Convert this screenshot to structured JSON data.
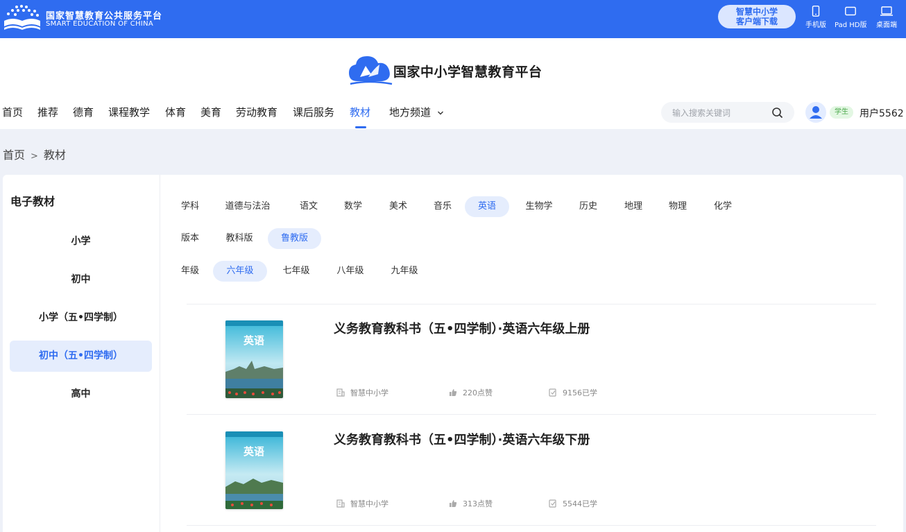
{
  "topbar": {
    "org_name_cn": "国家智慧教育公共服务平台",
    "org_name_en": "SMART EDUCATION OF CHINA",
    "download_line1": "智慧中小学",
    "download_line2": "客户端下载",
    "devices": [
      {
        "icon": "phone-icon",
        "label": "手机版"
      },
      {
        "icon": "tablet-icon",
        "label": "Pad HD版"
      },
      {
        "icon": "laptop-icon",
        "label": "桌面端"
      }
    ]
  },
  "header": {
    "brand": "国家中小学智慧教育平台",
    "nav": [
      "首页",
      "推荐",
      "德育",
      "课程教学",
      "体育",
      "美育",
      "劳动教育",
      "课后服务",
      "教材",
      "地方频道"
    ],
    "active_nav": "教材",
    "search_placeholder": "输入搜索关键词",
    "role": "学生",
    "username": "用户5562"
  },
  "breadcrumb": {
    "home": "首页",
    "sep": ">",
    "current": "教材"
  },
  "sidebar": {
    "title": "电子教材",
    "items": [
      "小学",
      "初中",
      "小学（五•四学制）",
      "初中（五•四学制）",
      "高中"
    ],
    "active": "初中（五•四学制）"
  },
  "filters": {
    "subject_label": "学科",
    "subjects": [
      "道德与法治",
      "语文",
      "数学",
      "美术",
      "音乐",
      "英语",
      "生物学",
      "历史",
      "地理",
      "物理",
      "化学"
    ],
    "subject_active": "英语",
    "edition_label": "版本",
    "editions": [
      "教科版",
      "鲁教版"
    ],
    "edition_active": "鲁教版",
    "grade_label": "年级",
    "grades": [
      "六年级",
      "七年级",
      "八年级",
      "九年级"
    ],
    "grade_active": "六年级"
  },
  "books": [
    {
      "title": "义务教育教科书（五•四学制）·英语六年级上册",
      "cover_text": "英语",
      "source": "智慧中小学",
      "likes": "220点赞",
      "learned": "9156已学"
    },
    {
      "title": "义务教育教科书（五•四学制）·英语六年级下册",
      "cover_text": "英语",
      "source": "智慧中小学",
      "likes": "313点赞",
      "learned": "5544已学"
    }
  ],
  "colors": {
    "brand_blue": "#2f6cf0",
    "active_bg": "#e5edfd",
    "page_bg": "#eef1f8"
  }
}
